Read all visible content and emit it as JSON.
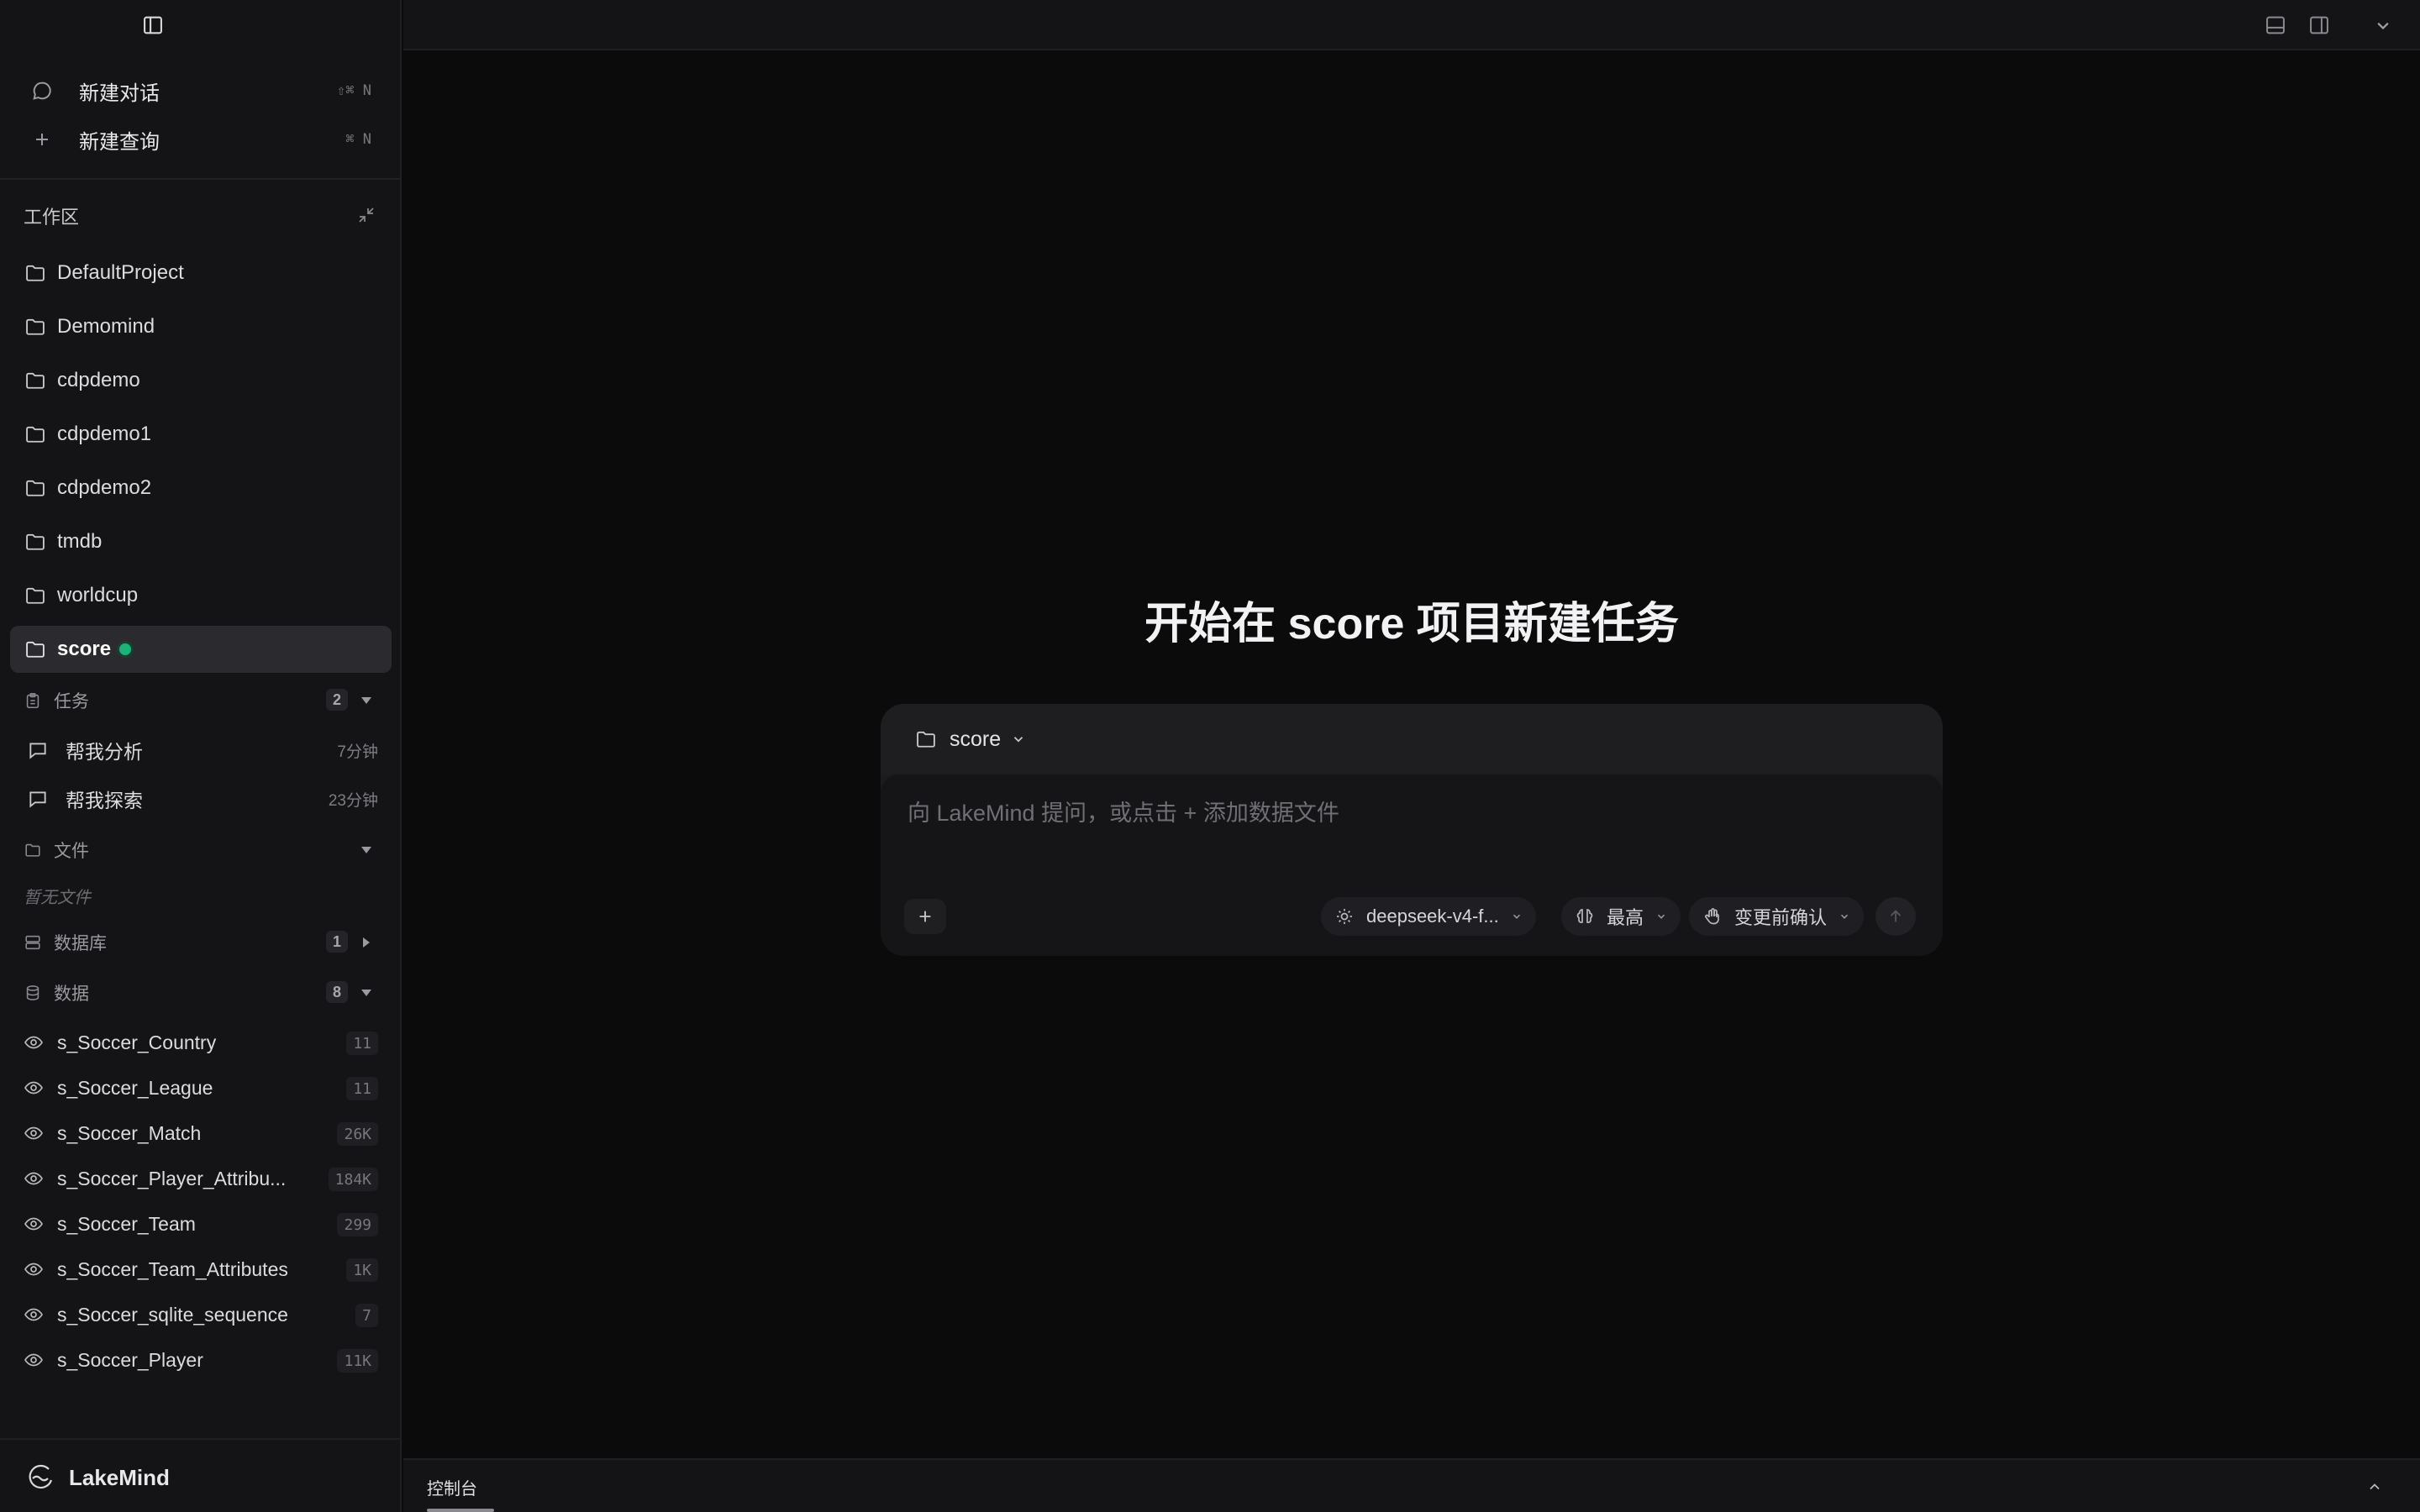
{
  "sidebar": {
    "actions": [
      {
        "label": "新建对话",
        "shortcut": "⇧⌘ N",
        "icon": "chat-bubble-icon"
      },
      {
        "label": "新建查询",
        "shortcut": "⌘ N",
        "icon": "plus-icon"
      }
    ],
    "workspace": {
      "label": "工作区",
      "projects": [
        "DefaultProject",
        "Demomind",
        "cdpdemo",
        "cdpdemo1",
        "cdpdemo2",
        "tmdb",
        "worldcup",
        "score"
      ],
      "active_project": "score",
      "active_status_color": "#1bb37a"
    },
    "tasks": {
      "label": "任务",
      "count": "2",
      "items": [
        {
          "label": "帮我分析",
          "time": "7分钟"
        },
        {
          "label": "帮我探索",
          "time": "23分钟"
        }
      ]
    },
    "files": {
      "label": "文件",
      "empty_text": "暂无文件"
    },
    "database": {
      "label": "数据库",
      "count": "1"
    },
    "data": {
      "label": "数据",
      "count": "8",
      "tables": [
        {
          "name": "s_Soccer_Country",
          "count": "11"
        },
        {
          "name": "s_Soccer_League",
          "count": "11"
        },
        {
          "name": "s_Soccer_Match",
          "count": "26K"
        },
        {
          "name": "s_Soccer_Player_Attribu...",
          "count": "184K"
        },
        {
          "name": "s_Soccer_Team",
          "count": "299"
        },
        {
          "name": "s_Soccer_Team_Attributes",
          "count": "1K"
        },
        {
          "name": "s_Soccer_sqlite_sequence",
          "count": "7"
        },
        {
          "name": "s_Soccer_Player",
          "count": "11K"
        }
      ]
    },
    "footer": {
      "brand": "LakeMind"
    }
  },
  "main": {
    "title": "开始在 score 项目新建任务",
    "composer": {
      "project": "score",
      "placeholder": "向 LakeMind 提问，或点击 + 添加数据文件",
      "value": "",
      "model": "deepseek-v4-f...",
      "effort": "最高",
      "mode": "变更前确认"
    }
  },
  "console": {
    "tab_label": "控制台"
  },
  "colors": {
    "accent_green": "#1bb37a",
    "background": "#0b0b0c",
    "sidebar": "#141416"
  }
}
